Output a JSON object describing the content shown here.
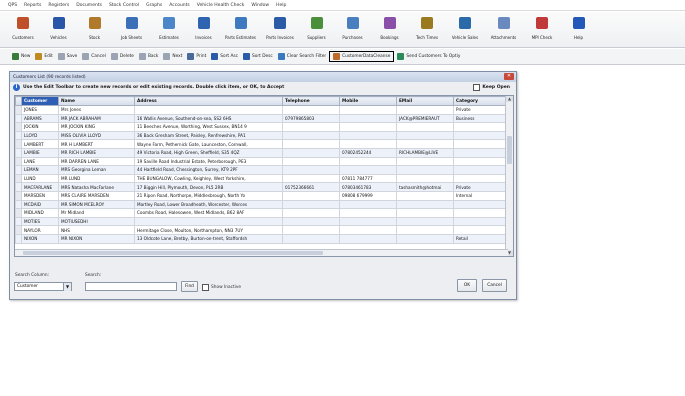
{
  "menu": [
    "QPS",
    "Reports",
    "Registers",
    "Documents",
    "Stock Control",
    "Graphs",
    "Accounts",
    "Vehicle Health Check",
    "Window",
    "Help"
  ],
  "toolbar": [
    {
      "label": "Customers",
      "color": "#c0502a"
    },
    {
      "label": "Vehicles",
      "color": "#2a56a8"
    },
    {
      "label": "Stock",
      "color": "#b07a2a"
    },
    {
      "label": "Job Sheets",
      "color": "#3b6fb8"
    },
    {
      "label": "Estimates",
      "color": "#4a86c8"
    },
    {
      "label": "Invoices",
      "color": "#2f64b0"
    },
    {
      "label": "Parts Estimates",
      "color": "#3f7ac0"
    },
    {
      "label": "Parts Invoices",
      "color": "#2d5ca6"
    },
    {
      "label": "Suppliers",
      "color": "#4b8f3a"
    },
    {
      "label": "Purchases",
      "color": "#4a7fbf"
    },
    {
      "label": "Bookings",
      "color": "#8a4fa8"
    },
    {
      "label": "Tech Times",
      "color": "#9a7a20"
    },
    {
      "label": "Vehicle Sales",
      "color": "#2a6aa8"
    },
    {
      "label": "Attachments",
      "color": "#6a8abf"
    },
    {
      "label": "MPI Check",
      "color": "#c03a3a"
    },
    {
      "label": "Help",
      "color": "#2357b8"
    }
  ],
  "toolbar2": [
    {
      "label": "New",
      "color": "#3a7a3a"
    },
    {
      "label": "Edit",
      "color": "#c08a20"
    },
    {
      "label": "Save",
      "color": "#9aa4b2"
    },
    {
      "label": "Cancel",
      "color": "#9aa4b2"
    },
    {
      "label": "Delete",
      "color": "#9aa4b2"
    },
    {
      "label": "Back",
      "color": "#9aa4b2"
    },
    {
      "label": "Next",
      "color": "#9aa4b2"
    },
    {
      "label": "Print",
      "color": "#4a6a9a"
    },
    {
      "label": "Sort Asc",
      "color": "#2a5aa8"
    },
    {
      "label": "Sort Desc",
      "color": "#2a5aa8"
    },
    {
      "label": "Clear Search Filter",
      "color": "#3a78c0"
    },
    {
      "label": "CustomerDataCleanse",
      "color": "#c06a2a"
    },
    {
      "label": "Send Customers To Optiy",
      "color": "#2a8a5a"
    }
  ],
  "dialog": {
    "title": "Customers List (90 records listed)",
    "info": "Use the Edit Toolbar to create new records or edit existing records. Double click item, or OK, to Accept",
    "keep_open": "Keep Open",
    "columns": [
      "Customer",
      "Name",
      "Address",
      "Telephone",
      "Mobile",
      "EMail",
      "Category"
    ],
    "rows": [
      [
        "JONES",
        "Mrs Jones",
        "",
        "",
        "",
        "",
        "Private"
      ],
      [
        "ABRAMS",
        "MR JACK ABRAHAM",
        "16 Wallis Avenue, Southend-on-sea, SS2 6HS",
        "07979865803",
        "",
        "JACK@PREMIERAUT",
        "Business"
      ],
      [
        "JOCKIN",
        "MR JOCKIN KING",
        "11 Beeches Avenue, Worthing, West Sussex, BN14 9",
        "",
        "",
        "",
        ""
      ],
      [
        "LLOYD",
        "MISS OLIVIA LLOYD",
        "36 Back Gresham Street, Paisley, Renfrewshire, PA1",
        "",
        "",
        "",
        ""
      ],
      [
        "LAMBERT",
        "MR H LAMBERT",
        "Wayne Farm, Pethernick Gate, Launceston, Cornwall,",
        "",
        "",
        "",
        ""
      ],
      [
        "LAMBIE",
        "MR RICH LAMBIE",
        "49 Victoria Road, High Green, Sheffield, S35 4QZ",
        "",
        "07802452244",
        "RICHLAMBIE@LIVE",
        ""
      ],
      [
        "LANE",
        "MR DARREN LANE",
        "19 Saville Road Industrial Estate, Peterborough, PE3",
        "",
        "",
        "",
        ""
      ],
      [
        "LEMAN",
        "MRS Georgina Leman",
        "44 Hartfield Road, Chessington, Surrey, KT9 2PF",
        "",
        "",
        "",
        ""
      ],
      [
        "LUND",
        "MR LUND",
        "THE BUNGALOW, Cowling, Keighley, West Yorkshire,",
        "",
        "07811 784777",
        "",
        ""
      ],
      [
        "MACFARLANE",
        "MRS Natasha MacFarlane",
        "17 Biggin Hill, Plymouth, Devon, PL5 2RB",
        "01752366661",
        "07803461783",
        "tashasmith@hotmai",
        "Private"
      ],
      [
        "MARSDEN",
        "MRS CLAIRE MARSDEN",
        "21 Ripon Road, Northorpe, Middlesbrough, North Yo",
        "",
        "09808 679999",
        "",
        "Internal"
      ],
      [
        "MCDAID",
        "MR SIMON MCELROY",
        "Martley Road, Lower Broadheath, Worcester, Worces",
        "",
        "",
        "",
        ""
      ],
      [
        "MIDLAND",
        "Mr Midland",
        "Coombs Road, Halesowen, West Midlands, B62 8AF",
        "",
        "",
        "",
        ""
      ],
      [
        "MOTIES",
        "MOTIUSEDHI",
        "",
        "",
        "",
        "",
        ""
      ],
      [
        "NAYLOR",
        "NHS",
        "Hermitage Close, Moulton, Northampton, NN3 7UY",
        "",
        "",
        "",
        ""
      ],
      [
        "NIXON",
        "MR NIXON",
        "13 Oldcote Lane, Bretby, Burton-on-trent, Staffordsh",
        "",
        "",
        "",
        "Retail"
      ]
    ],
    "search_column_label": "Search Column:",
    "search_column_value": "Customer",
    "search_label": "Search:",
    "search_value": "",
    "find_label": "Find",
    "show_inactive_label": "Show Inactive",
    "ok_label": "OK",
    "cancel_label": "Cancel"
  }
}
